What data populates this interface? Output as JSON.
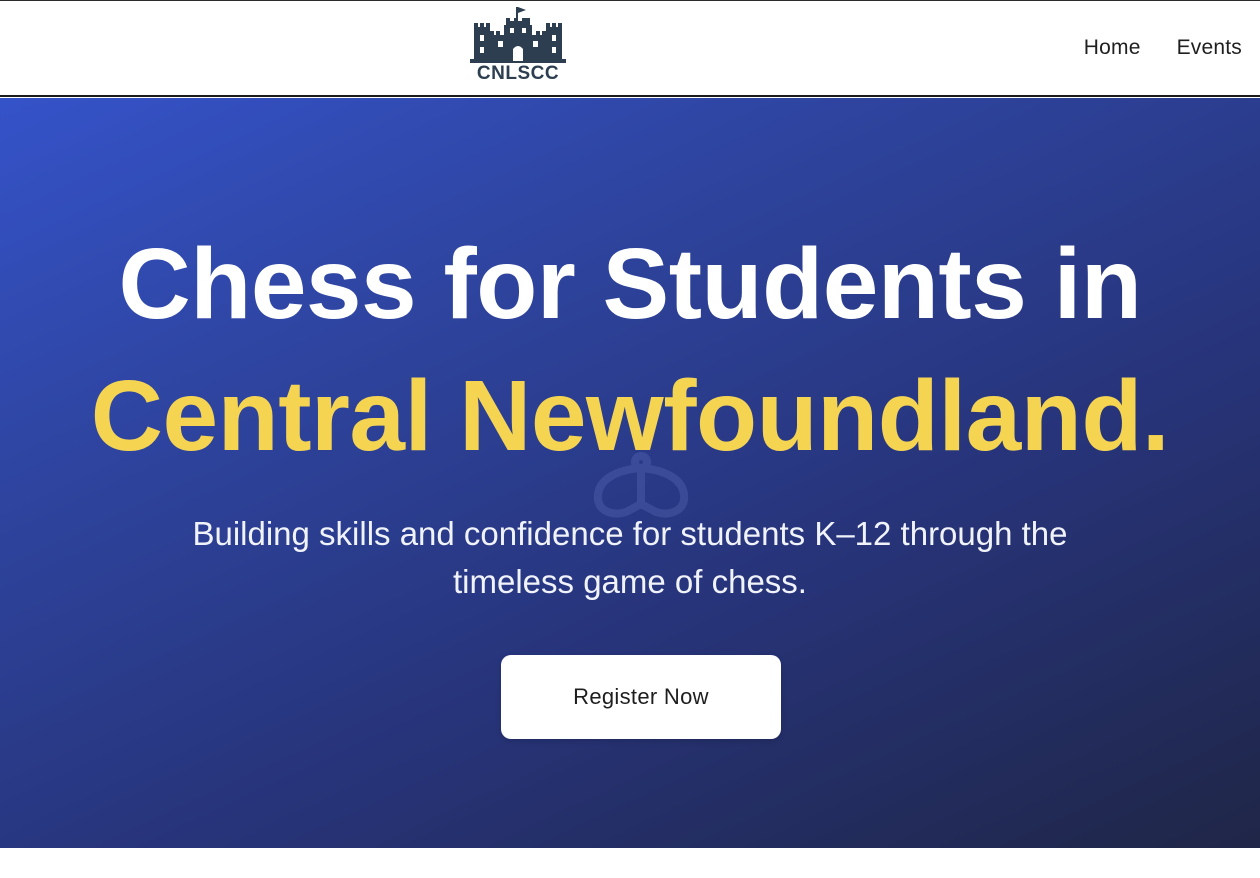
{
  "brand": {
    "logo_text": "CNLSCC",
    "logo_icon": "castle-icon",
    "logo_color": "#2c3e50"
  },
  "nav": {
    "items": [
      {
        "label": "Home"
      },
      {
        "label": "Events"
      }
    ]
  },
  "hero": {
    "title_line1": "Chess for Students in",
    "title_line2": "Central Newfoundland.",
    "subtitle": "Building skills and confidence for students K–12 through the timeless game of chess.",
    "cta_label": "Register Now",
    "watermark_icon": "chess-king-icon",
    "colors": {
      "gradient_start": "#3553c9",
      "gradient_end": "#1f2647",
      "title_primary": "#ffffff",
      "title_accent": "#f5d452"
    }
  }
}
